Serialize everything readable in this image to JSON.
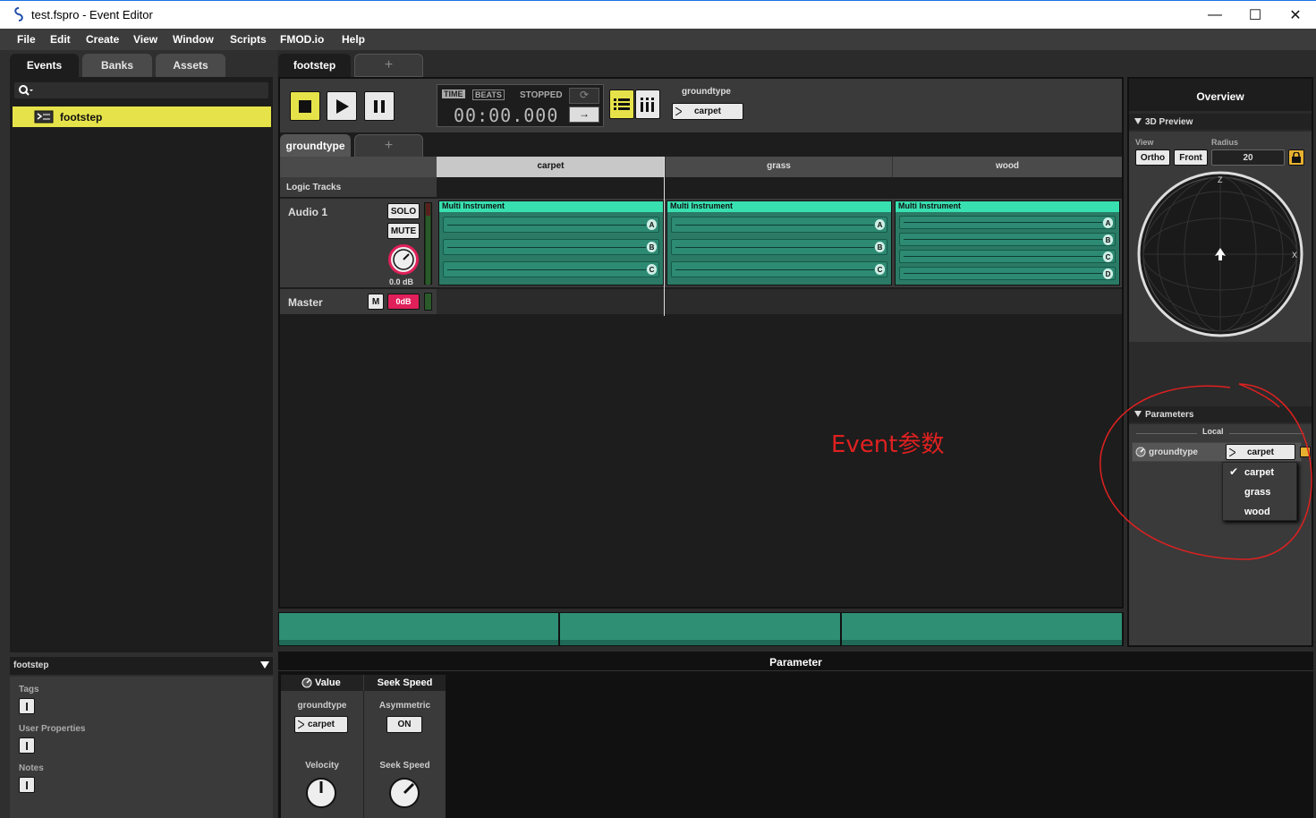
{
  "window": {
    "title": "test.fspro - Event Editor",
    "min": "—",
    "max": "☐",
    "close": "✕"
  },
  "menu": [
    "File",
    "Edit",
    "Create",
    "View",
    "Window",
    "Scripts",
    "FMOD.io",
    "Help"
  ],
  "browser": {
    "tabs": [
      "Events",
      "Banks",
      "Assets"
    ],
    "search_icon": "search-icon",
    "items": [
      {
        "label": "footstep",
        "selected": true
      }
    ],
    "props": {
      "title": "footstep",
      "tags": "Tags",
      "user_properties": "User Properties",
      "notes": "Notes"
    }
  },
  "editor": {
    "tab": "footstep",
    "transport": {
      "time_label": "TIME",
      "beats_label": "BEATS",
      "status": "STOPPED",
      "time": "00:00.000"
    },
    "param_pill": {
      "label": "groundtype",
      "value": "carpet"
    },
    "sheet_tab": "groundtype",
    "columns": [
      "carpet",
      "grass",
      "wood"
    ],
    "logic_tracks": "Logic Tracks",
    "audio_track": {
      "name": "Audio 1",
      "solo": "SOLO",
      "mute": "MUTE",
      "gain": "0.0 dB"
    },
    "master": {
      "name": "Master",
      "m": "M",
      "db": "0dB"
    },
    "instruments": [
      {
        "name": "Multi Instrument",
        "slots": [
          "A",
          "B",
          "C"
        ]
      },
      {
        "name": "Multi Instrument",
        "slots": [
          "A",
          "B",
          "C"
        ]
      },
      {
        "name": "Multi Instrument",
        "slots": [
          "A",
          "B",
          "C",
          "D"
        ]
      }
    ]
  },
  "overview": {
    "title": "Overview",
    "preview": {
      "title": "3D Preview",
      "view_label": "View",
      "radius_label": "Radius",
      "ortho": "Ortho",
      "front": "Front",
      "radius": "20",
      "axis_z": "Z",
      "axis_x": "X"
    },
    "parameters": {
      "title": "Parameters",
      "local": "Local",
      "name": "groundtype",
      "value": "carpet",
      "options": [
        "carpet",
        "grass",
        "wood"
      ],
      "checked": "carpet"
    }
  },
  "annotation": {
    "text": "Event参数",
    "color": "#e02020"
  },
  "deck": {
    "title": "Parameter",
    "value_tab": "Value",
    "seek_tab": "Seek Speed",
    "groundtype": "groundtype",
    "groundtype_value": "carpet",
    "asymmetric": "Asymmetric",
    "asym_value": "ON",
    "velocity": "Velocity",
    "seek_speed": "Seek Speed"
  },
  "colors": {
    "accent": "#e6e34a",
    "teal": "#38e0b0",
    "pink": "#e0205a"
  }
}
